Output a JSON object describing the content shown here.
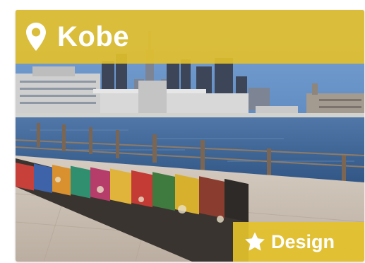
{
  "card": {
    "title": "Kobe",
    "title_icon": "map-pin-icon",
    "tag": "Design",
    "tag_icon": "star-icon",
    "photo": "kobe-harbor-photo",
    "colors": {
      "accent_yellow": "#E4C12A",
      "text": "#FFFFFF",
      "sky": "#5F8EC6",
      "water": "#3D6392",
      "pavement": "#C9BDB1"
    }
  }
}
